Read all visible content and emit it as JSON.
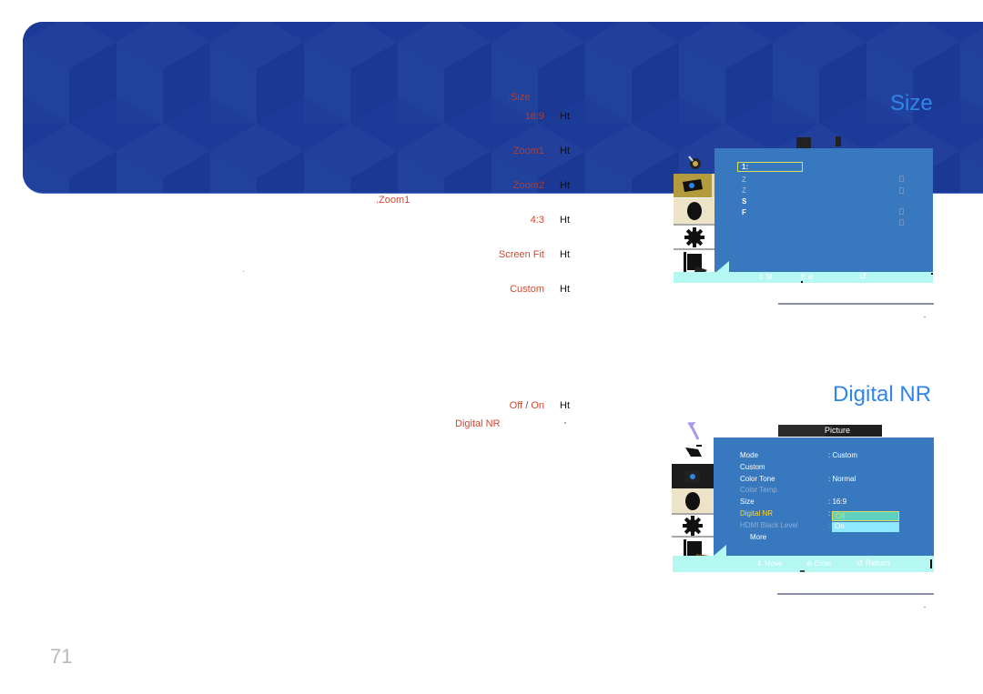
{
  "page_number": "71",
  "banner": {
    "color": "#1c3a98"
  },
  "size_section": {
    "title": "Size",
    "label": ".Size",
    "default_note": ".Zoom1",
    "options": [
      {
        "label": "16:9",
        "suffix": "Ht"
      },
      {
        "label": "Zoom1",
        "suffix": "Ht"
      },
      {
        "label": "Zoom2",
        "suffix": "Ht"
      },
      {
        "label": "4:3",
        "suffix": "Ht"
      },
      {
        "label": "Screen Fit",
        "suffix": "Ht"
      },
      {
        "label": "Custom",
        "suffix": "Ht"
      }
    ],
    "osd": {
      "selected_item": "1:",
      "items": [
        "Z",
        "Z",
        "S",
        "F"
      ],
      "bottom_bar": {
        "move": "M",
        "enter": "E",
        "return_icon": "return-icon"
      }
    }
  },
  "digital_nr_section": {
    "title": "Digital NR",
    "values_label": "Off",
    "separator": "/",
    "values_label2": "On",
    "suffix": "Ht",
    "label": "Digital NR",
    "osd": {
      "header": "Picture",
      "rows": [
        {
          "label": "Mode",
          "value": ": Custom",
          "state": "normal"
        },
        {
          "label": "Custom",
          "value": "",
          "state": "normal"
        },
        {
          "label": "Color Tone",
          "value": ": Normal",
          "state": "normal"
        },
        {
          "label": "Color Temp.",
          "value": "",
          "state": "disabled"
        },
        {
          "label": "Size",
          "value": ": 16:9",
          "state": "normal"
        },
        {
          "label": "Digital NR",
          "value": ":",
          "state": "active"
        },
        {
          "label": "HDMI Black Level",
          "value": ":",
          "state": "disabled"
        },
        {
          "label": "More",
          "value": "",
          "state": "normal"
        }
      ],
      "dropdown": [
        "Off",
        "On"
      ],
      "dropdown_selected": "Off",
      "bottom_bar": {
        "move": "Move",
        "enter": "Enter",
        "return": "Return"
      }
    }
  }
}
